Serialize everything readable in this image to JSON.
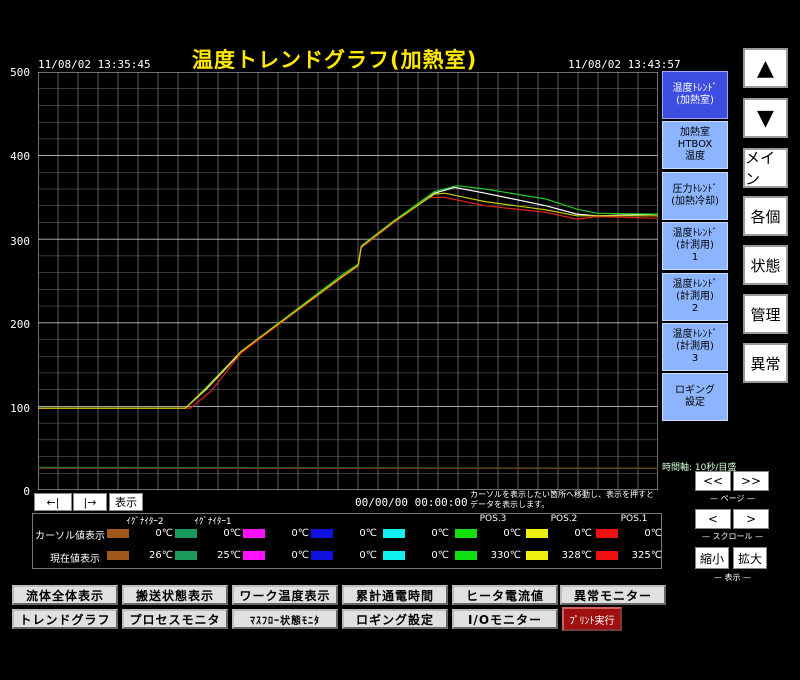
{
  "header": {
    "title": "温度トレンドグラフ(加熱室)",
    "start_time": "11/08/02 13:35:45",
    "end_time": "11/08/02 13:43:57"
  },
  "chart_data": {
    "type": "line",
    "ylim": [
      0,
      500
    ],
    "yticks": [
      "500",
      "400",
      "300",
      "200",
      "100",
      "0"
    ],
    "grid": true,
    "time_axis_note": "時間軸: 10秒/目盛",
    "x_unit": "seconds from 13:35:45",
    "series": [
      {
        "color": "#ffffff",
        "points": [
          [
            0,
            98
          ],
          [
            145,
            98
          ],
          [
            165,
            120
          ],
          [
            200,
            165
          ],
          [
            250,
            210
          ],
          [
            300,
            255
          ],
          [
            315,
            268
          ],
          [
            318,
            290
          ],
          [
            350,
            320
          ],
          [
            390,
            355
          ],
          [
            410,
            362
          ],
          [
            440,
            355
          ],
          [
            500,
            340
          ],
          [
            530,
            330
          ],
          [
            550,
            328
          ],
          [
            610,
            330
          ]
        ]
      },
      {
        "color": "#22cc22",
        "points": [
          [
            0,
            98
          ],
          [
            145,
            98
          ],
          [
            165,
            122
          ],
          [
            200,
            166
          ],
          [
            250,
            212
          ],
          [
            300,
            258
          ],
          [
            315,
            270
          ],
          [
            318,
            292
          ],
          [
            350,
            322
          ],
          [
            390,
            357
          ],
          [
            412,
            364
          ],
          [
            440,
            360
          ],
          [
            500,
            348
          ],
          [
            530,
            336
          ],
          [
            550,
            331
          ],
          [
            610,
            330
          ]
        ]
      },
      {
        "color": "#dd2222",
        "points": [
          [
            0,
            98
          ],
          [
            150,
            98
          ],
          [
            170,
            118
          ],
          [
            200,
            164
          ],
          [
            250,
            210
          ],
          [
            300,
            255
          ],
          [
            315,
            268
          ],
          [
            318,
            290
          ],
          [
            350,
            320
          ],
          [
            385,
            350
          ],
          [
            400,
            350
          ],
          [
            440,
            340
          ],
          [
            500,
            332
          ],
          [
            530,
            324
          ],
          [
            550,
            327
          ],
          [
            610,
            325
          ]
        ]
      },
      {
        "color": "#c8c800",
        "points": [
          [
            0,
            98
          ],
          [
            145,
            98
          ],
          [
            165,
            121
          ],
          [
            200,
            166
          ],
          [
            250,
            211
          ],
          [
            300,
            256
          ],
          [
            315,
            269
          ],
          [
            318,
            291
          ],
          [
            350,
            321
          ],
          [
            390,
            354
          ],
          [
            400,
            355
          ],
          [
            440,
            345
          ],
          [
            500,
            335
          ],
          [
            530,
            328
          ],
          [
            550,
            328
          ],
          [
            610,
            328
          ]
        ]
      },
      {
        "color": "#1a7a3a",
        "points": [
          [
            0,
            27
          ],
          [
            610,
            26
          ]
        ]
      },
      {
        "color": "#7a3a10",
        "points": [
          [
            0,
            26
          ],
          [
            610,
            26
          ]
        ]
      }
    ]
  },
  "pages": [
    {
      "label": "温度ﾄﾚﾝﾄﾞ\n(加熱室)",
      "active": true
    },
    {
      "label": "加熱室\nHTBOX\n温度",
      "active": false
    },
    {
      "label": "圧力ﾄﾚﾝﾄﾞ\n(加熱冷却)",
      "active": false
    },
    {
      "label": "温度ﾄﾚﾝﾄﾞ\n(計測用)\n1",
      "active": false
    },
    {
      "label": "温度ﾄﾚﾝﾄﾞ\n(計測用)\n2",
      "active": false
    },
    {
      "label": "温度ﾄﾚﾝﾄﾞ\n(計測用)\n3",
      "active": false
    },
    {
      "label": "ロギング\n設定",
      "active": false
    }
  ],
  "right_nav": {
    "up": "▲",
    "down": "▼",
    "items": [
      "メイン",
      "各個",
      "状態",
      "管理",
      "異常"
    ]
  },
  "cursor": {
    "left": "←|",
    "right": "|→",
    "show": "表示",
    "datetime": "00/00/00 00:00:00",
    "hint": "カーソルを表示したい箇所へ移動し、表示を押すとデータを表示します。"
  },
  "nav": {
    "time_axis": "時間軸: 10秒/目盛",
    "page_prev": "<<",
    "page_next": ">>",
    "page_label": "ページ",
    "scroll_prev": "<",
    "scroll_next": ">",
    "scroll_label": "スクロール",
    "zoom_out": "縮小",
    "zoom_in": "拡大",
    "display_label": "表示"
  },
  "legend": {
    "row_cursor": "カーソル値表示",
    "row_current": "現在値表示",
    "channels": [
      {
        "name": "ｲｸﾞﾅｲﾀｰ2",
        "color": "#a0581a",
        "cursor": "0℃",
        "current": "26℃"
      },
      {
        "name": "ｲｸﾞﾅｲﾀｰ1",
        "color": "#1a9a5a",
        "cursor": "0℃",
        "current": "25℃"
      },
      {
        "name": "",
        "color": "#ff10ff",
        "cursor": "0℃",
        "current": "0℃"
      },
      {
        "name": "",
        "color": "#1010e0",
        "cursor": "0℃",
        "current": "0℃"
      },
      {
        "name": "",
        "color": "#10f0f0",
        "cursor": "0℃",
        "current": "0℃"
      },
      {
        "name": "POS.3",
        "color": "#10e010",
        "cursor": "0℃",
        "current": "330℃"
      },
      {
        "name": "POS.2",
        "color": "#f0f010",
        "cursor": "0℃",
        "current": "328℃"
      },
      {
        "name": "POS.1",
        "color": "#f01010",
        "cursor": "0℃",
        "current": "325℃"
      }
    ]
  },
  "bottom_buttons": {
    "row1": [
      "流体全体表示",
      "搬送状態表示",
      "ワーク温度表示",
      "累計通電時間",
      "ヒータ電流値",
      "異常モニター"
    ],
    "row2": [
      "トレンドグラフ",
      "プロセスモニタ",
      "ﾏｽﾌﾛｰ状態ﾓﾆﾀ",
      "ロギング設定",
      "I/Oモニター"
    ],
    "print": "ﾌﾟﾘﾝﾄ実行"
  }
}
